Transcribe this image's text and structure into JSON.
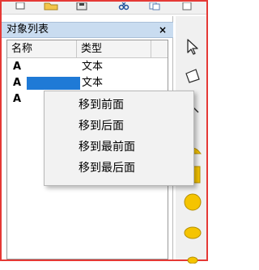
{
  "panel": {
    "title": "对象列表",
    "close_symbol": "×"
  },
  "list": {
    "columns": [
      "名称",
      "类型"
    ],
    "rows": [
      {
        "icon": "A",
        "name": "",
        "type": "文本",
        "selected": false
      },
      {
        "icon": "A",
        "name": "",
        "type": "文本",
        "selected": true
      },
      {
        "icon": "A",
        "name": "",
        "type": "",
        "selected": false
      }
    ]
  },
  "context_menu": {
    "items": [
      "移到前面",
      "移到后面",
      "移到最前面",
      "移到最后面"
    ]
  },
  "palette": {
    "tools": [
      "pointer-arrow-icon",
      "shape-select-icon",
      "line-tool-icon",
      "half-circle-icon",
      "rectangle-icon",
      "circle-icon",
      "ellipse-icon",
      "small-shape-icon"
    ]
  },
  "toolbar": {
    "icons": [
      "document-icon",
      "folder-icon",
      "save-icon",
      "scissors-icon",
      "copy-icon",
      "paste-icon"
    ]
  },
  "colors": {
    "frame_border": "#e53935",
    "panel_title_bg": "#c9dcf0",
    "selection": "#1f7ad6",
    "shape_fill": "#f5c400"
  }
}
